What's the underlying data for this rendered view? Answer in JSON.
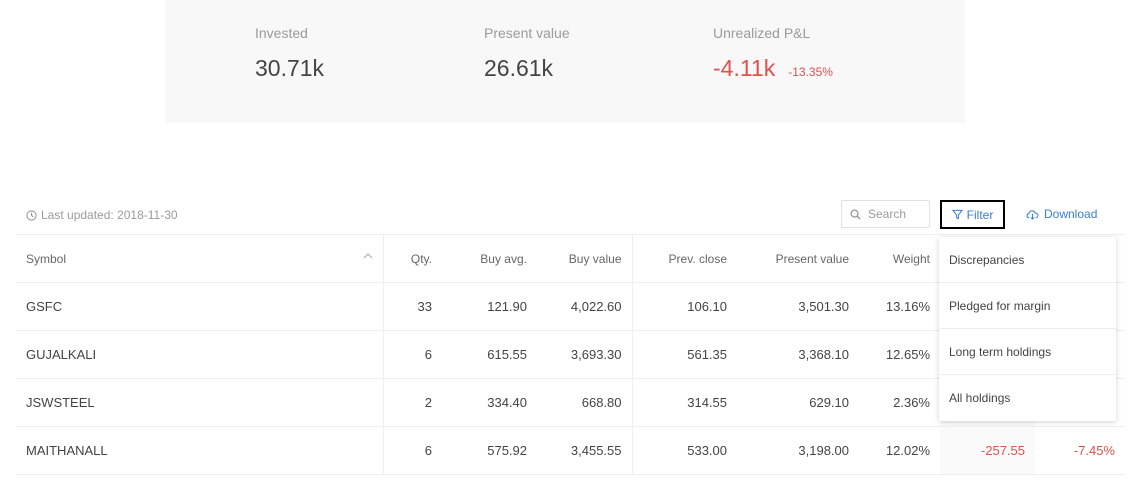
{
  "summary": {
    "invested": {
      "label": "Invested",
      "value": "30.71k"
    },
    "present": {
      "label": "Present value",
      "value": "26.61k"
    },
    "pnl": {
      "label": "Unrealized P&L",
      "value": "-4.11k",
      "pct": "-13.35%"
    }
  },
  "toolbar": {
    "last_updated": "Last updated: 2018-11-30",
    "search_placeholder": "Search",
    "filter_label": "Filter",
    "download_label": "Download"
  },
  "table": {
    "headers": {
      "symbol": "Symbol",
      "qty": "Qty.",
      "buy_avg": "Buy avg.",
      "buy_value": "Buy value",
      "prev_close": "Prev. close",
      "present_value": "Present value",
      "weight": "Weight"
    },
    "rows": [
      {
        "symbol": "GSFC",
        "qty": "33",
        "buy_avg": "121.90",
        "buy_value": "4,022.60",
        "prev_close": "106.10",
        "present_value": "3,501.30",
        "weight": "13.16%",
        "pnl": "",
        "chg": ""
      },
      {
        "symbol": "GUJALKALI",
        "qty": "6",
        "buy_avg": "615.55",
        "buy_value": "3,693.30",
        "prev_close": "561.35",
        "present_value": "3,368.10",
        "weight": "12.65%",
        "pnl": "",
        "chg": ""
      },
      {
        "symbol": "JSWSTEEL",
        "qty": "2",
        "buy_avg": "334.40",
        "buy_value": "668.80",
        "prev_close": "314.55",
        "present_value": "629.10",
        "weight": "2.36%",
        "pnl": "",
        "chg": ""
      },
      {
        "symbol": "MAITHANALL",
        "qty": "6",
        "buy_avg": "575.92",
        "buy_value": "3,455.55",
        "prev_close": "533.00",
        "present_value": "3,198.00",
        "weight": "12.02%",
        "pnl": "-257.55",
        "chg": "-7.45%"
      }
    ]
  },
  "filter_menu": {
    "items": [
      "Discrepancies",
      "Pledged for margin",
      "Long term holdings",
      "All holdings"
    ]
  },
  "colors": {
    "accent": "#387ed1",
    "loss": "#df514c"
  },
  "icons": {
    "clock": "clock-icon",
    "search": "search-icon",
    "filter": "funnel-icon",
    "download": "cloud-download-icon",
    "sort": "chevron-up-icon"
  }
}
